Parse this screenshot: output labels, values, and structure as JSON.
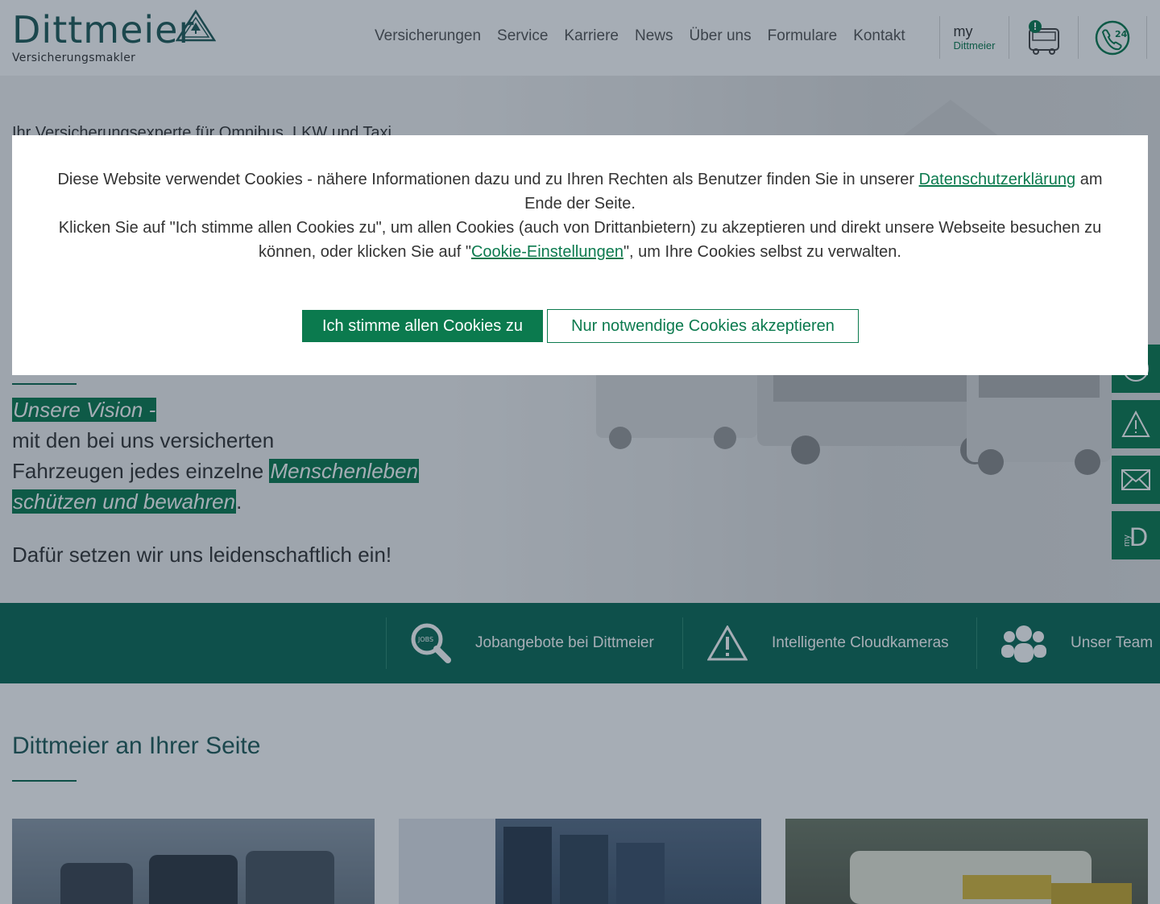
{
  "header": {
    "logo_name": "Dittmeier",
    "logo_sub": "Versicherungsmakler",
    "nav": [
      "Versicherungen",
      "Service",
      "Karriere",
      "News",
      "Über uns",
      "Formulare",
      "Kontakt"
    ],
    "my_label": "my",
    "my_brand": "Dittmeier"
  },
  "hero": {
    "tagline": "Ihr Versicherungsexperte für Omnibus, LKW und Taxi",
    "vision_highlight": "Unsere Vision -",
    "vision_line1": "mit den bei uns versicherten",
    "vision_line2a": "Fahrzeugen jedes einzelne ",
    "vision_highlight2a": "Menschenleben",
    "vision_highlight2b": "schützen und bewahren",
    "vision_end": ".",
    "claim": "Dafür setzen wir uns leidenschaftlich ein!"
  },
  "side_tabs": [
    "phone-24-icon",
    "warning-icon",
    "mail-icon",
    "my-dittmeier-icon"
  ],
  "band": {
    "items": [
      {
        "label": "Jobangebote bei Dittmeier",
        "icon": "jobs-search-icon"
      },
      {
        "label": "Intelligente Cloudkameras",
        "icon": "warning-icon"
      },
      {
        "label": "Unser Team",
        "icon": "team-icon"
      }
    ]
  },
  "section": {
    "title": "Dittmeier an Ihrer Seite"
  },
  "cookie": {
    "text1": "Diese Website verwendet Cookies - nähere Informationen dazu und zu Ihren Rechten als Benutzer finden Sie in unserer ",
    "link1": "Datenschutzerklärung",
    "text2": " am Ende der Seite.",
    "text3": "Klicken Sie auf \"Ich stimme allen Cookies zu\", um allen Cookies (auch von Drittanbietern) zu akzeptieren und direkt unsere Webseite besuchen zu können, oder klicken Sie auf \"",
    "link2": "Cookie-Einstellungen",
    "text4": "\", um Ihre Cookies selbst zu verwalten.",
    "accept_label": "Ich stimme allen Cookies zu",
    "necessary_label": "Nur notwendige Cookies akzeptieren"
  },
  "colors": {
    "brand_green": "#0b7a4e",
    "band_green": "#0b6a55",
    "logo_teal": "#1f5b57"
  }
}
